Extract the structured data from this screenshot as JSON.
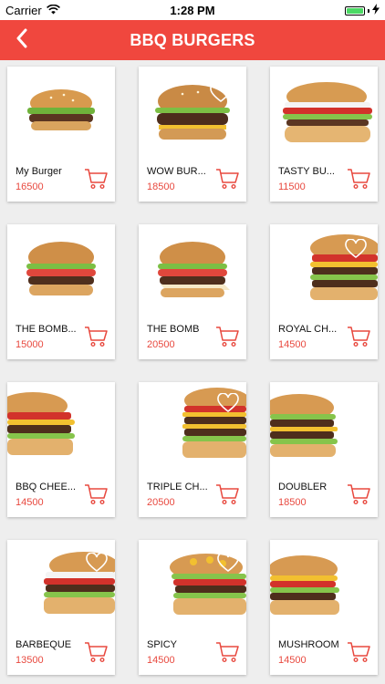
{
  "status": {
    "carrier": "Carrier",
    "time": "1:28 PM"
  },
  "header": {
    "title": "BBQ BURGERS"
  },
  "products": [
    {
      "name": "My Burger",
      "price": "16500"
    },
    {
      "name": "WOW BUR...",
      "price": "18500"
    },
    {
      "name": "TASTY BU...",
      "price": "11500"
    },
    {
      "name": "THE BOMB...",
      "price": "15000"
    },
    {
      "name": "THE BOMB",
      "price": "20500"
    },
    {
      "name": "ROYAL CH...",
      "price": "14500"
    },
    {
      "name": "BBQ CHEE...",
      "price": "14500"
    },
    {
      "name": "TRIPLE CH...",
      "price": "20500"
    },
    {
      "name": "DOUBLER",
      "price": "18500"
    },
    {
      "name": "BARBEQUE",
      "price": "13500"
    },
    {
      "name": "SPICY",
      "price": "14500"
    },
    {
      "name": "MUSHROOM",
      "price": "14500"
    }
  ],
  "colors": {
    "accent": "#f0473e",
    "price": "#e8493f"
  },
  "icons": {
    "back": "back-arrow-icon",
    "cart": "cart-icon",
    "favorite": "heart-outline-icon",
    "wifi": "wifi-icon",
    "battery": "battery-icon",
    "charging": "charging-bolt-icon"
  }
}
